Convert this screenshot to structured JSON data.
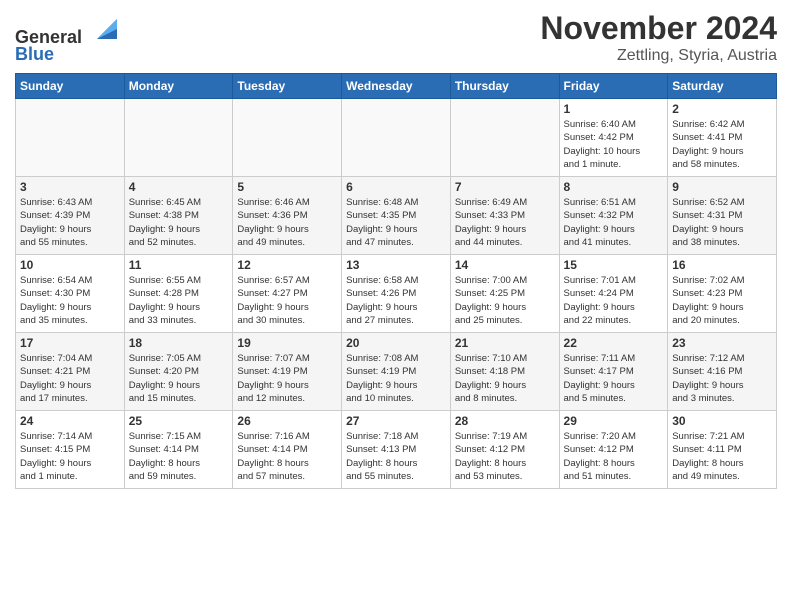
{
  "header": {
    "logo_line1": "General",
    "logo_line2": "Blue",
    "month": "November 2024",
    "location": "Zettling, Styria, Austria"
  },
  "weekdays": [
    "Sunday",
    "Monday",
    "Tuesday",
    "Wednesday",
    "Thursday",
    "Friday",
    "Saturday"
  ],
  "weeks": [
    [
      {
        "day": "",
        "info": ""
      },
      {
        "day": "",
        "info": ""
      },
      {
        "day": "",
        "info": ""
      },
      {
        "day": "",
        "info": ""
      },
      {
        "day": "",
        "info": ""
      },
      {
        "day": "1",
        "info": "Sunrise: 6:40 AM\nSunset: 4:42 PM\nDaylight: 10 hours\nand 1 minute."
      },
      {
        "day": "2",
        "info": "Sunrise: 6:42 AM\nSunset: 4:41 PM\nDaylight: 9 hours\nand 58 minutes."
      }
    ],
    [
      {
        "day": "3",
        "info": "Sunrise: 6:43 AM\nSunset: 4:39 PM\nDaylight: 9 hours\nand 55 minutes."
      },
      {
        "day": "4",
        "info": "Sunrise: 6:45 AM\nSunset: 4:38 PM\nDaylight: 9 hours\nand 52 minutes."
      },
      {
        "day": "5",
        "info": "Sunrise: 6:46 AM\nSunset: 4:36 PM\nDaylight: 9 hours\nand 49 minutes."
      },
      {
        "day": "6",
        "info": "Sunrise: 6:48 AM\nSunset: 4:35 PM\nDaylight: 9 hours\nand 47 minutes."
      },
      {
        "day": "7",
        "info": "Sunrise: 6:49 AM\nSunset: 4:33 PM\nDaylight: 9 hours\nand 44 minutes."
      },
      {
        "day": "8",
        "info": "Sunrise: 6:51 AM\nSunset: 4:32 PM\nDaylight: 9 hours\nand 41 minutes."
      },
      {
        "day": "9",
        "info": "Sunrise: 6:52 AM\nSunset: 4:31 PM\nDaylight: 9 hours\nand 38 minutes."
      }
    ],
    [
      {
        "day": "10",
        "info": "Sunrise: 6:54 AM\nSunset: 4:30 PM\nDaylight: 9 hours\nand 35 minutes."
      },
      {
        "day": "11",
        "info": "Sunrise: 6:55 AM\nSunset: 4:28 PM\nDaylight: 9 hours\nand 33 minutes."
      },
      {
        "day": "12",
        "info": "Sunrise: 6:57 AM\nSunset: 4:27 PM\nDaylight: 9 hours\nand 30 minutes."
      },
      {
        "day": "13",
        "info": "Sunrise: 6:58 AM\nSunset: 4:26 PM\nDaylight: 9 hours\nand 27 minutes."
      },
      {
        "day": "14",
        "info": "Sunrise: 7:00 AM\nSunset: 4:25 PM\nDaylight: 9 hours\nand 25 minutes."
      },
      {
        "day": "15",
        "info": "Sunrise: 7:01 AM\nSunset: 4:24 PM\nDaylight: 9 hours\nand 22 minutes."
      },
      {
        "day": "16",
        "info": "Sunrise: 7:02 AM\nSunset: 4:23 PM\nDaylight: 9 hours\nand 20 minutes."
      }
    ],
    [
      {
        "day": "17",
        "info": "Sunrise: 7:04 AM\nSunset: 4:21 PM\nDaylight: 9 hours\nand 17 minutes."
      },
      {
        "day": "18",
        "info": "Sunrise: 7:05 AM\nSunset: 4:20 PM\nDaylight: 9 hours\nand 15 minutes."
      },
      {
        "day": "19",
        "info": "Sunrise: 7:07 AM\nSunset: 4:19 PM\nDaylight: 9 hours\nand 12 minutes."
      },
      {
        "day": "20",
        "info": "Sunrise: 7:08 AM\nSunset: 4:19 PM\nDaylight: 9 hours\nand 10 minutes."
      },
      {
        "day": "21",
        "info": "Sunrise: 7:10 AM\nSunset: 4:18 PM\nDaylight: 9 hours\nand 8 minutes."
      },
      {
        "day": "22",
        "info": "Sunrise: 7:11 AM\nSunset: 4:17 PM\nDaylight: 9 hours\nand 5 minutes."
      },
      {
        "day": "23",
        "info": "Sunrise: 7:12 AM\nSunset: 4:16 PM\nDaylight: 9 hours\nand 3 minutes."
      }
    ],
    [
      {
        "day": "24",
        "info": "Sunrise: 7:14 AM\nSunset: 4:15 PM\nDaylight: 9 hours\nand 1 minute."
      },
      {
        "day": "25",
        "info": "Sunrise: 7:15 AM\nSunset: 4:14 PM\nDaylight: 8 hours\nand 59 minutes."
      },
      {
        "day": "26",
        "info": "Sunrise: 7:16 AM\nSunset: 4:14 PM\nDaylight: 8 hours\nand 57 minutes."
      },
      {
        "day": "27",
        "info": "Sunrise: 7:18 AM\nSunset: 4:13 PM\nDaylight: 8 hours\nand 55 minutes."
      },
      {
        "day": "28",
        "info": "Sunrise: 7:19 AM\nSunset: 4:12 PM\nDaylight: 8 hours\nand 53 minutes."
      },
      {
        "day": "29",
        "info": "Sunrise: 7:20 AM\nSunset: 4:12 PM\nDaylight: 8 hours\nand 51 minutes."
      },
      {
        "day": "30",
        "info": "Sunrise: 7:21 AM\nSunset: 4:11 PM\nDaylight: 8 hours\nand 49 minutes."
      }
    ]
  ]
}
